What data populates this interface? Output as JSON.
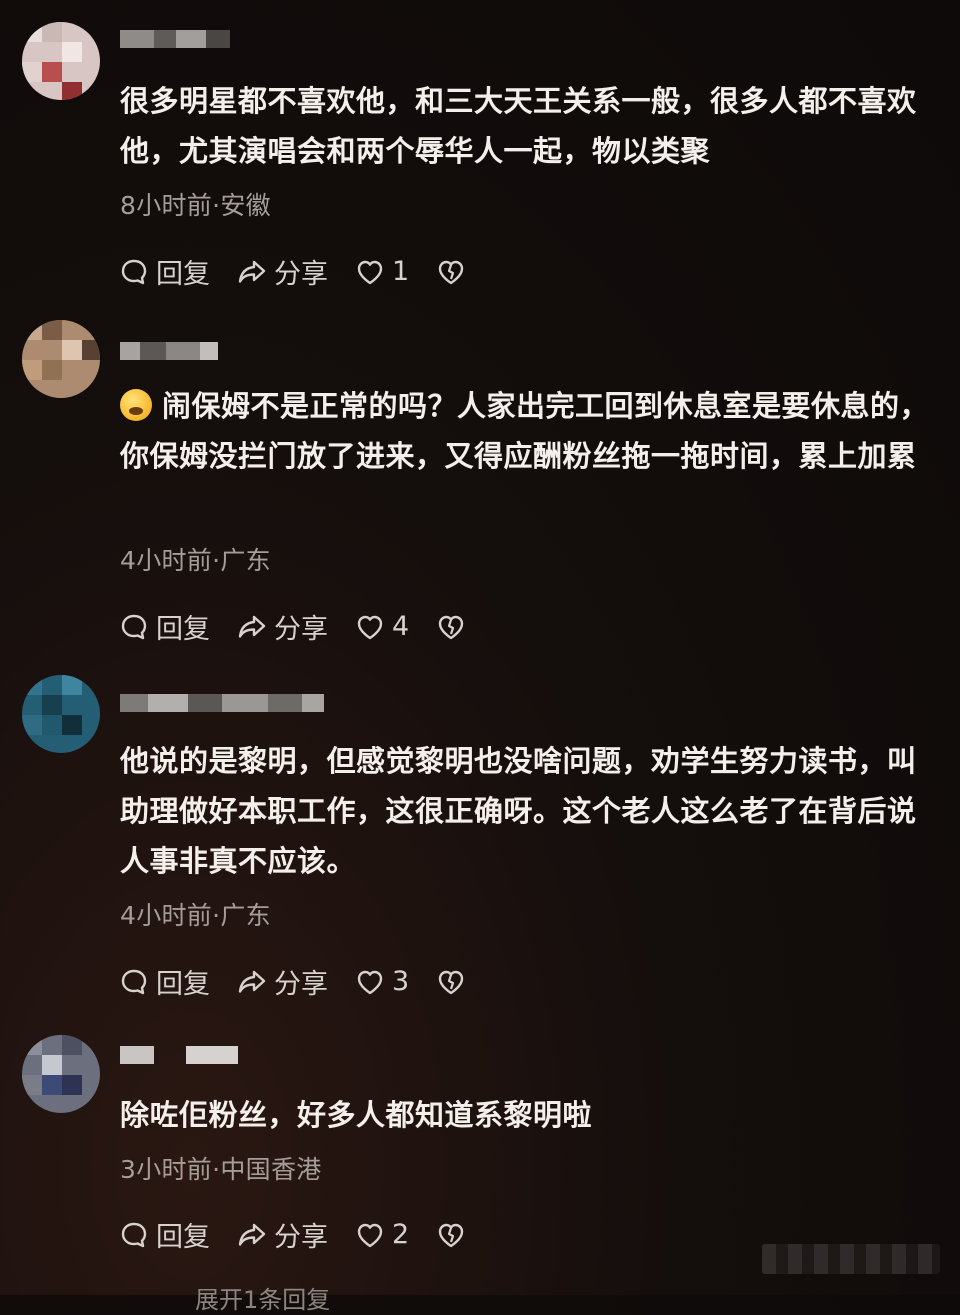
{
  "comments": [
    {
      "text": "很多明星都不喜欢他，和三大天王关系一般，很多人都不喜欢他，尤其演唱会和两个辱华人一起，物以类聚",
      "meta": "8小时前·安徽",
      "reply_label": "回复",
      "share_label": "分享",
      "likes": "1"
    },
    {
      "emoji": "cold-sweat-emoji",
      "text": "闹保姆不是正常的吗？人家出完工回到休息室是要休息的，你保姆没拦门放了进来，又得应酬粉丝拖一拖时间，累上加累",
      "meta": "4小时前·广东",
      "reply_label": "回复",
      "share_label": "分享",
      "likes": "4"
    },
    {
      "text": "他说的是黎明，但感觉黎明也没啥问题，劝学生努力读书，叫助理做好本职工作，这很正确呀。这个老人这么老了在背后说人事非真不应该。",
      "meta": "4小时前·广东",
      "reply_label": "回复",
      "share_label": "分享",
      "likes": "3"
    },
    {
      "text": "除咗佢粉丝，好多人都知道系黎明啦",
      "meta": "3小时前·中国香港",
      "reply_label": "回复",
      "share_label": "分享",
      "likes": "2"
    }
  ],
  "more_replies": "展开1条回复",
  "colors": {
    "background": "#0d0a09",
    "text": "#f4efea",
    "meta": "#a59d99"
  },
  "icons": [
    "reply-bubble-icon",
    "share-arrow-icon",
    "heart-icon",
    "broken-heart-icon"
  ]
}
